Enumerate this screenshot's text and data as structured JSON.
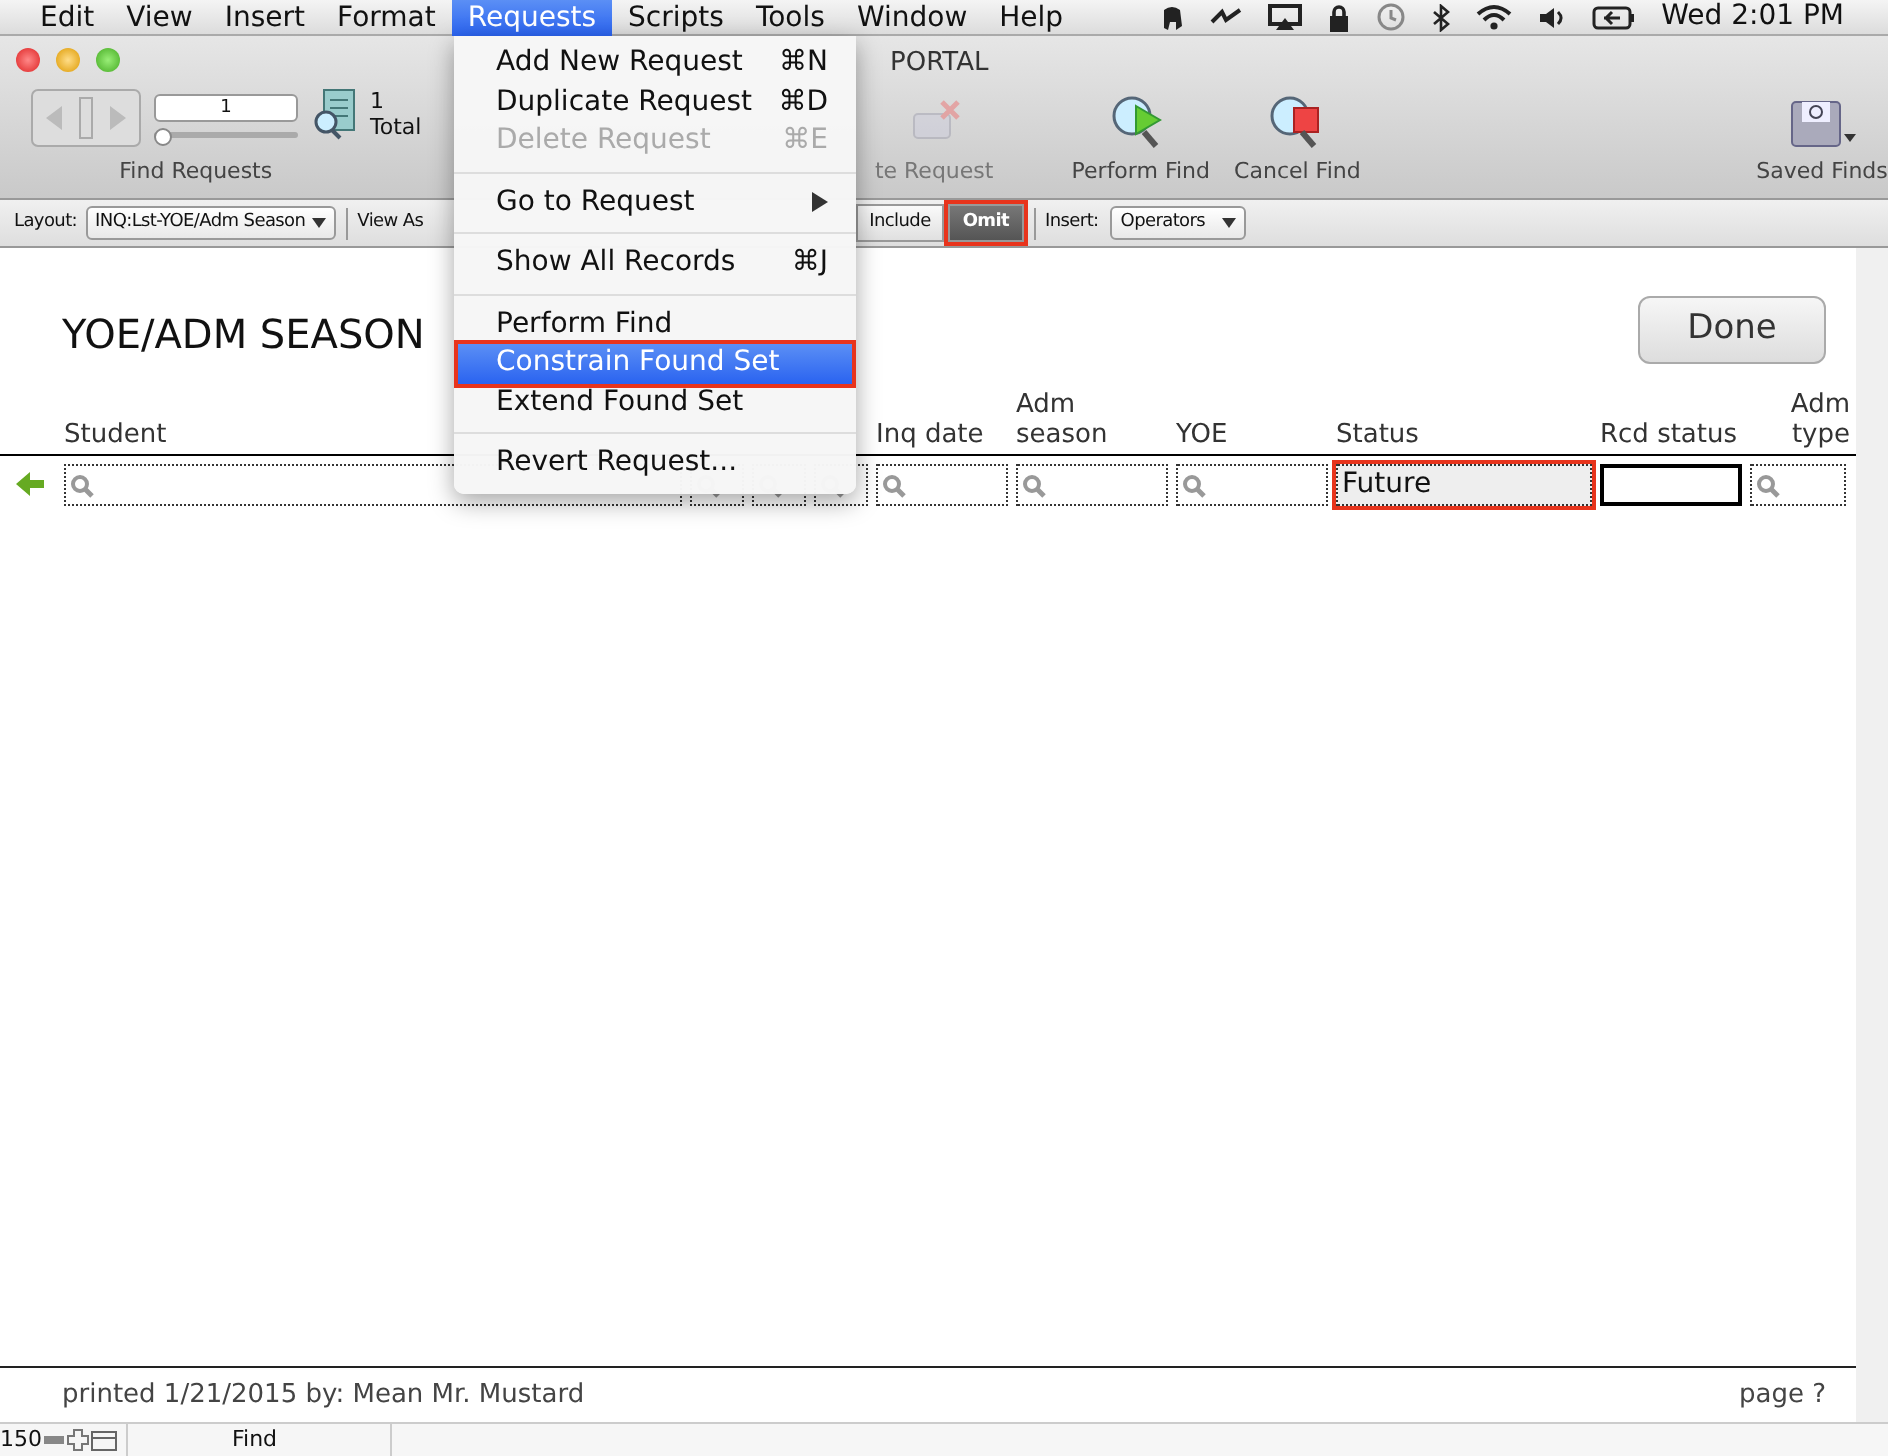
{
  "menubar": {
    "items": [
      {
        "label": "Edit",
        "selected": false
      },
      {
        "label": "View",
        "selected": false
      },
      {
        "label": "Insert",
        "selected": false
      },
      {
        "label": "Format",
        "selected": false
      },
      {
        "label": "Requests",
        "selected": true
      },
      {
        "label": "Scripts",
        "selected": false
      },
      {
        "label": "Tools",
        "selected": false
      },
      {
        "label": "Window",
        "selected": false
      },
      {
        "label": "Help",
        "selected": false
      }
    ],
    "clock": "Wed 2:01 PM"
  },
  "window": {
    "title": "PORTAL"
  },
  "toolbar": {
    "record": {
      "value": "1",
      "level": 0,
      "count": "1",
      "count_label": "Total",
      "label": "Find Requests"
    },
    "buttons": [
      {
        "kind": "delete",
        "label": "te Request",
        "disabled": true
      },
      {
        "kind": "perform",
        "label": "Perform Find",
        "disabled": false
      },
      {
        "kind": "cancel",
        "label": "Cancel Find",
        "disabled": false
      },
      {
        "kind": "saved",
        "label": "Saved Finds",
        "disabled": false
      }
    ]
  },
  "layout_bar": {
    "layout_label": "Layout:",
    "layout_value": "INQ:Lst-YOE/Adm Season",
    "view_as_label": "View As",
    "modes": [
      {
        "label": "Include",
        "selected": false,
        "highlighted": false
      },
      {
        "label": "Omit",
        "selected": true,
        "highlighted": true
      }
    ],
    "insert_label": "Insert:",
    "insert_value": "Operators"
  },
  "requests_menu": [
    {
      "kind": "item",
      "label": "Add New Request",
      "shortcut": "⌘N",
      "disabled": false,
      "selected": false,
      "highlighted": false
    },
    {
      "kind": "item",
      "label": "Duplicate Request",
      "shortcut": "⌘D",
      "disabled": false,
      "selected": false,
      "highlighted": false
    },
    {
      "kind": "item",
      "label": "Delete Request",
      "shortcut": "⌘E",
      "disabled": true,
      "selected": false,
      "highlighted": false
    },
    {
      "kind": "separator"
    },
    {
      "kind": "submenu",
      "label": "Go to Request",
      "disabled": false,
      "selected": false,
      "highlighted": false
    },
    {
      "kind": "separator"
    },
    {
      "kind": "item",
      "label": "Show All Records",
      "shortcut": "⌘J",
      "disabled": false,
      "selected": false,
      "highlighted": false
    },
    {
      "kind": "separator"
    },
    {
      "kind": "item",
      "label": "Perform Find",
      "disabled": false,
      "selected": false,
      "highlighted": false
    },
    {
      "kind": "item",
      "label": "Constrain Found Set",
      "disabled": false,
      "selected": true,
      "highlighted": true
    },
    {
      "kind": "item",
      "label": "Extend Found Set",
      "disabled": false,
      "selected": false,
      "highlighted": false
    },
    {
      "kind": "separator"
    },
    {
      "kind": "item",
      "label": "Revert Request...",
      "disabled": false,
      "selected": false,
      "highlighted": false
    }
  ],
  "report": {
    "title": "YOE/ADM SEASON",
    "done_button": "Done",
    "columns": [
      {
        "header": [
          "Student"
        ],
        "field": {
          "kind": "search"
        }
      },
      {
        "field": {
          "kind": "search"
        }
      },
      {
        "field": {
          "kind": "search"
        }
      },
      {
        "field": {
          "kind": "search"
        }
      },
      {
        "header": [
          "Inq date"
        ],
        "field": {
          "kind": "search"
        }
      },
      {
        "header": [
          "Adm",
          "season"
        ],
        "field": {
          "kind": "search"
        }
      },
      {
        "header": [
          "YOE"
        ],
        "field": {
          "kind": "search"
        }
      },
      {
        "header": [
          "Status"
        ],
        "field": {
          "kind": "value",
          "value": "Future",
          "highlighted": true
        }
      },
      {
        "header": [
          "Rcd status"
        ],
        "field": {
          "kind": "empty",
          "active": true
        }
      },
      {
        "header": [
          "Adm",
          "type"
        ],
        "field": {
          "kind": "search"
        }
      }
    ],
    "footer_left": "printed 1/21/2015 by: Mean Mr. Mustard",
    "footer_right": "page ?"
  },
  "status_bar": {
    "zoom": "150",
    "mode": "Find"
  }
}
